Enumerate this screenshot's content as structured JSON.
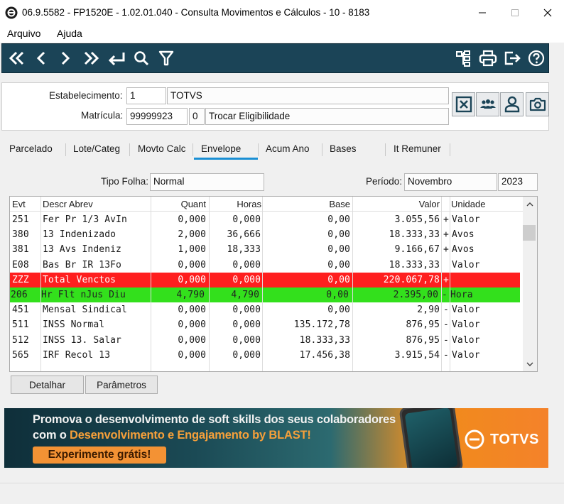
{
  "window": {
    "title": "06.9.5582 - FP1520E - 1.02.01.040 - Consulta Movimentos e Cálculos - 10 - 8183",
    "colors": {
      "toolbar": "#1b4457",
      "selected_tab": "#1a8fd4",
      "total_row": "#ff1f1f",
      "highlight_row": "#33e01c"
    }
  },
  "menu": {
    "file": "Arquivo",
    "help": "Ajuda"
  },
  "toolbar_icons": [
    "first-record-icon",
    "previous-record-icon",
    "next-record-icon",
    "last-record-icon",
    "return-icon",
    "search-icon",
    "filter-icon",
    "hierarchy-icon",
    "print-icon",
    "exit-icon",
    "help-icon"
  ],
  "header": {
    "estabelecimento_label": "Estabelecimento:",
    "estabelecimento_code": "1",
    "estabelecimento_name": "TOTVS",
    "matricula_label": "Matrícula:",
    "matricula_code": "99999923",
    "matricula_seq": "0",
    "matricula_name": "Trocar Eligibilidade"
  },
  "tabs": [
    "Parcelado",
    "Lote/Categ",
    "Movto Calc",
    "Envelope",
    "Acum Ano",
    "Bases",
    "It Remuner"
  ],
  "selected_tab": "Envelope",
  "filters": {
    "tipo_folha_label": "Tipo Folha:",
    "tipo_folha": "Normal",
    "periodo_label": "Período:",
    "periodo_mes": "Novembro",
    "periodo_ano": "2023"
  },
  "table": {
    "columns": [
      "Evt",
      "Descr Abrev",
      "Quant",
      "Horas",
      "Base",
      "Valor",
      "Unidade"
    ],
    "rows": [
      {
        "evt": "251",
        "descr": "Fer Pr 1/3 AvIn",
        "quant": "0,000",
        "horas": "0,000",
        "base": "0,00",
        "valor": "3.055,56",
        "sinal": "+",
        "unidade": "Valor",
        "style": ""
      },
      {
        "evt": "380",
        "descr": "13 Indenizado",
        "quant": "2,000",
        "horas": "36,666",
        "base": "0,00",
        "valor": "18.333,33",
        "sinal": "+",
        "unidade": "Avos",
        "style": ""
      },
      {
        "evt": "381",
        "descr": "13 Avs Indeniz",
        "quant": "1,000",
        "horas": "18,333",
        "base": "0,00",
        "valor": "9.166,67",
        "sinal": "+",
        "unidade": "Avos",
        "style": ""
      },
      {
        "evt": "E08",
        "descr": "Bas Br IR 13Fo",
        "quant": "0,000",
        "horas": "0,000",
        "base": "0,00",
        "valor": "18.333,33",
        "sinal": "",
        "unidade": "Valor",
        "style": ""
      },
      {
        "evt": "ZZZ",
        "descr": "Total Venctos",
        "quant": "0,000",
        "horas": "0,000",
        "base": "0,00",
        "valor": "220.067,78",
        "sinal": "+",
        "unidade": "",
        "style": "red"
      },
      {
        "evt": "206",
        "descr": "Hr Flt nJus Diu",
        "quant": "4,790",
        "horas": "4,790",
        "base": "0,00",
        "valor": "2.395,00",
        "sinal": "-",
        "unidade": "Hora",
        "style": "green"
      },
      {
        "evt": "451",
        "descr": "Mensal Sindical",
        "quant": "0,000",
        "horas": "0,000",
        "base": "0,00",
        "valor": "2,90",
        "sinal": "-",
        "unidade": "Valor",
        "style": ""
      },
      {
        "evt": "511",
        "descr": "INSS Normal",
        "quant": "0,000",
        "horas": "0,000",
        "base": "135.172,78",
        "valor": "876,95",
        "sinal": "-",
        "unidade": "Valor",
        "style": ""
      },
      {
        "evt": "512",
        "descr": "INSS 13. Salar",
        "quant": "0,000",
        "horas": "0,000",
        "base": "18.333,33",
        "valor": "876,95",
        "sinal": "-",
        "unidade": "Valor",
        "style": ""
      },
      {
        "evt": "565",
        "descr": "IRF Recol 13",
        "quant": "0,000",
        "horas": "0,000",
        "base": "17.456,38",
        "valor": "3.915,54",
        "sinal": "-",
        "unidade": "Valor",
        "style": ""
      }
    ]
  },
  "buttons": {
    "detalhar": "Detalhar",
    "parametros": "Parâmetros"
  },
  "banner": {
    "line1": "Promova o desenvolvimento de soft skills dos seus colaboradores",
    "line2_prefix": "com o ",
    "line2_highlight": "Desenvolvimento e Engajamento by BLAST!",
    "cta": "Experimente grátis!",
    "brand": "TOTVS"
  }
}
